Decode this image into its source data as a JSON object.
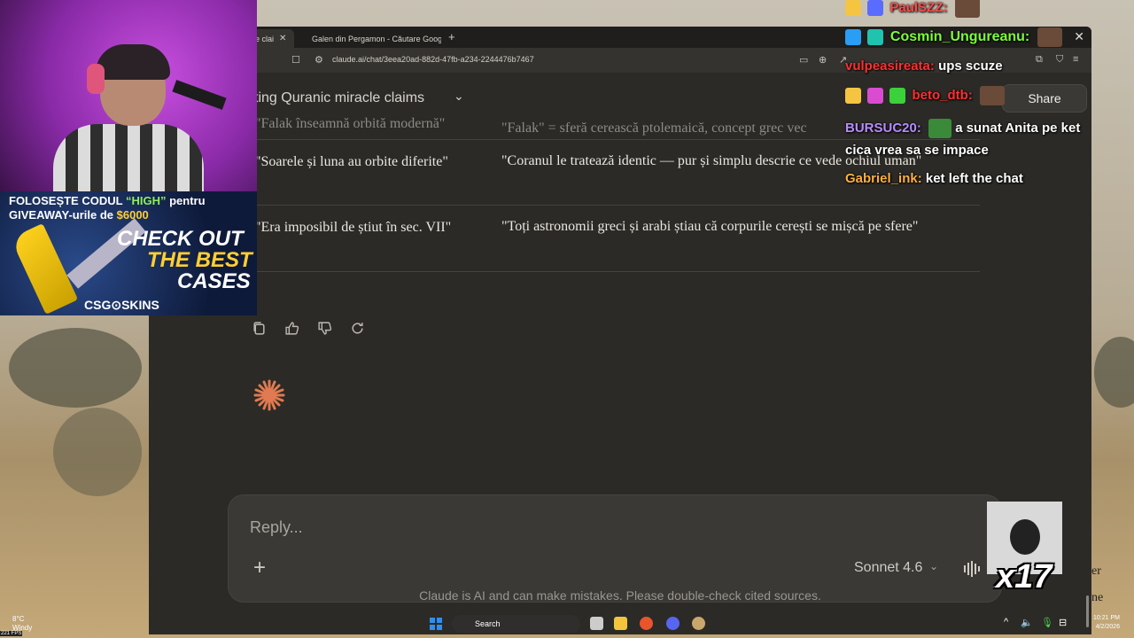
{
  "browser": {
    "tabs": [
      {
        "label": "e clai",
        "active": true
      },
      {
        "label": "Galen din Pergamon - Căutare Googl",
        "active": false
      }
    ],
    "url": "claude.ai/chat/3eea20ad-882d-47fb-a234-2244476b7467"
  },
  "claude": {
    "conversation_title": "ting Quranic miracle claims",
    "share_label": "Share",
    "table": {
      "rows": [
        {
          "claim": "\"Falak înseamnă orbită modernă\"",
          "reality": "\"Falak\" = sferă cerească ptolemaică, concept grec vec"
        },
        {
          "claim": "\"Soarele și luna au orbite diferite\"",
          "reality": "\"Coranul le tratează identic — pur și simplu descrie ce vede ochiul uman\""
        },
        {
          "claim": "\"Era imposibil de știut în sec. VII\"",
          "reality": "\"Toți astronomii greci și arabi știau că corpurile cerești se mișcă pe sfere\""
        }
      ]
    },
    "composer": {
      "placeholder": "Reply...",
      "model": "Sonnet 4.6"
    },
    "disclaimer": "Claude is AI and can make mistakes. Please double-check cited sources."
  },
  "stream": {
    "promo": {
      "line1_prefix": "FOLOSEȘTE CODUL",
      "code": "“HIGH”",
      "line1_suffix": "pentru",
      "line2_prefix": "GIVEAWAY-urile de",
      "amount": "$6000",
      "check": "CHECK OUT",
      "best": "THE BEST",
      "cases": "CASES",
      "brand": "CSG⊙SKINS"
    },
    "chat": [
      {
        "user": "PaulSZZ:",
        "message": "",
        "color": "#ff4a4a"
      },
      {
        "user": "Cosmin_Ungureanu:",
        "message": "",
        "color": "#7dff3a"
      },
      {
        "user": "vulpeasireata:",
        "message": "ups scuze",
        "color": "#ff3030"
      },
      {
        "user": "beto_dtb:",
        "message": "",
        "color": "#ff3030"
      },
      {
        "user": "BURSUC20:",
        "message": "a sunat Anita pe ket",
        "color": "#b88cff"
      },
      {
        "user": "",
        "message": "cica vrea sa se impace",
        "color": "#ffffff"
      },
      {
        "user": "Gabriel_ink:",
        "message": "ket left the chat",
        "color": "#ffb040"
      }
    ],
    "gif_counter": "x17"
  },
  "taskbar": {
    "weather_temp": "8°C",
    "weather_label": "Windy",
    "fps": "221 FPS",
    "search_label": "Search",
    "time": "10:21 PM",
    "date": "4/2/2026"
  },
  "edge_text": [
    "er",
    "ne"
  ]
}
